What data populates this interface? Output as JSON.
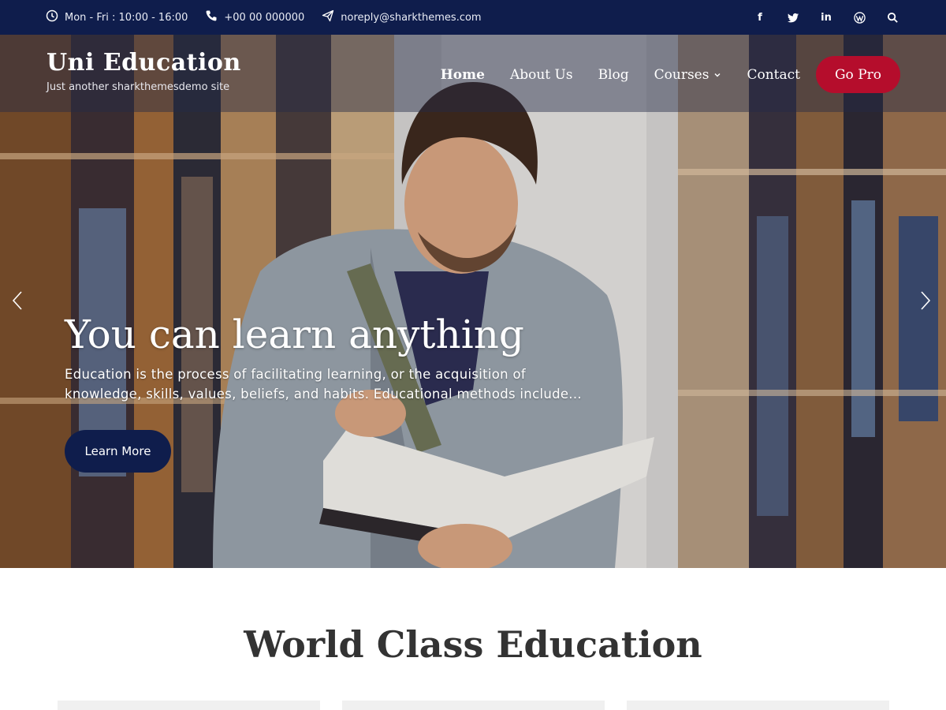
{
  "topbar": {
    "hours": "Mon - Fri : 10:00 - 16:00",
    "phone": "+00 00 000000",
    "email": "noreply@sharkthemes.com",
    "social": [
      {
        "icon": "facebook-icon",
        "glyph": "f"
      },
      {
        "icon": "twitter-icon",
        "glyph": "t"
      },
      {
        "icon": "linkedin-icon",
        "glyph": "in"
      },
      {
        "icon": "wordpress-icon",
        "glyph": "W"
      }
    ]
  },
  "header": {
    "site_title": "Uni Education",
    "site_description": "Just another sharkthemesdemo site",
    "nav": {
      "home": "Home",
      "about": "About Us",
      "blog": "Blog",
      "courses": "Courses",
      "contact": "Contact"
    },
    "cta": "Go Pro"
  },
  "hero": {
    "title": "You can learn anything",
    "description_line1": "Education is the process of facilitating learning, or the acquisition of",
    "description_line2": "knowledge, skills, values, beliefs, and habits. Educational methods include...",
    "button": "Learn More"
  },
  "section": {
    "title": "World Class Education"
  },
  "colors": {
    "topbar": "#0f1d4c",
    "accent": "#b50d2c",
    "button": "#0f1d4c"
  }
}
